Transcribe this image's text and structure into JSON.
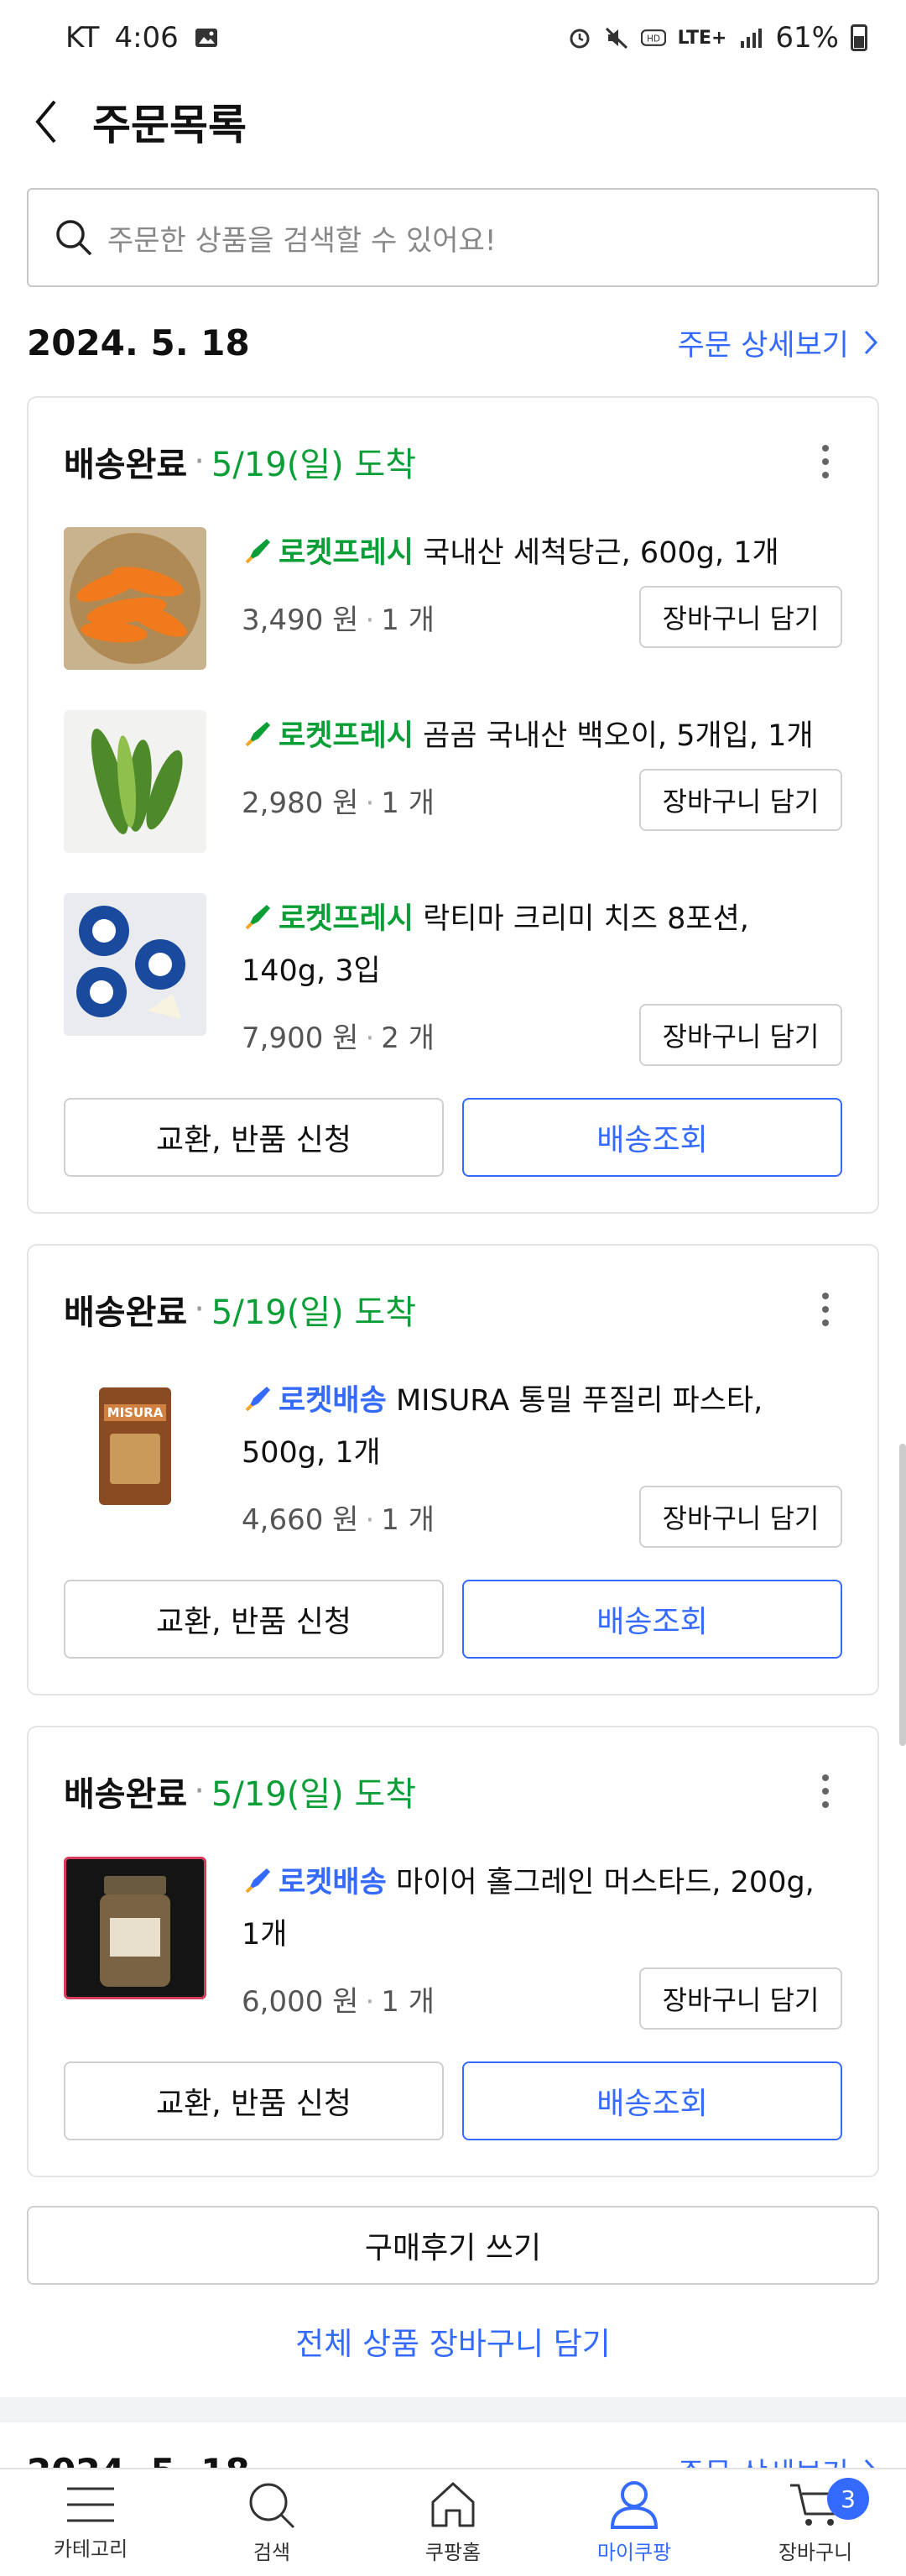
{
  "status_bar": {
    "carrier": "KT",
    "time": "4:06",
    "battery": "61%",
    "network": "LTE+"
  },
  "header": {
    "title": "주문목록"
  },
  "search": {
    "placeholder": "주문한 상품을 검색할 수 있어요!"
  },
  "orders": [
    {
      "date": "2024. 5. 18",
      "detail_label": "주문 상세보기",
      "shipments": [
        {
          "status": "배송완료",
          "arrival": "5/19(일) 도착",
          "items": [
            {
              "badge": "로켓프레시",
              "name": "국내산 세척당근, 600g, 1개",
              "price": "3,490 원",
              "qty": "1 개",
              "cart_label": "장바구니 담기"
            },
            {
              "badge": "로켓프레시",
              "name": "곰곰 국내산 백오이, 5개입, 1개",
              "price": "2,980 원",
              "qty": "1 개",
              "cart_label": "장바구니 담기"
            },
            {
              "badge": "로켓프레시",
              "name": "락티마 크리미 치즈 8포션, 140g, 3입",
              "price": "7,900 원",
              "qty": "2 개",
              "cart_label": "장바구니 담기"
            }
          ],
          "exchange_label": "교환, 반품 신청",
          "track_label": "배송조회"
        },
        {
          "status": "배송완료",
          "arrival": "5/19(일) 도착",
          "items": [
            {
              "badge": "로켓배송",
              "name": "MISURA 통밀 푸질리 파스타, 500g, 1개",
              "price": "4,660 원",
              "qty": "1 개",
              "cart_label": "장바구니 담기"
            }
          ],
          "exchange_label": "교환, 반품 신청",
          "track_label": "배송조회"
        },
        {
          "status": "배송완료",
          "arrival": "5/19(일) 도착",
          "items": [
            {
              "badge": "로켓배송",
              "name": "마이어 홀그레인 머스타드, 200g, 1개",
              "price": "6,000 원",
              "qty": "1 개",
              "cart_label": "장바구니 담기"
            }
          ],
          "exchange_label": "교환, 반품 신청",
          "track_label": "배송조회"
        }
      ],
      "review_label": "구매후기 쓰기",
      "cart_all_label": "전체 상품 장바구니 담기"
    },
    {
      "date": "2024. 5. 18",
      "detail_label": "주문 상세보기"
    }
  ],
  "bottom_nav": {
    "items": [
      {
        "label": "카테고리",
        "icon": "menu-icon"
      },
      {
        "label": "검색",
        "icon": "search-icon"
      },
      {
        "label": "쿠팡홈",
        "icon": "home-icon"
      },
      {
        "label": "마이쿠팡",
        "icon": "user-icon"
      },
      {
        "label": "장바구니",
        "icon": "cart-icon"
      }
    ],
    "active": "마이쿠팡",
    "cart_count": "3"
  },
  "colors": {
    "accent": "#346aff",
    "arrival_green": "#0a9e36",
    "fresh_green": "#0a9e36"
  }
}
